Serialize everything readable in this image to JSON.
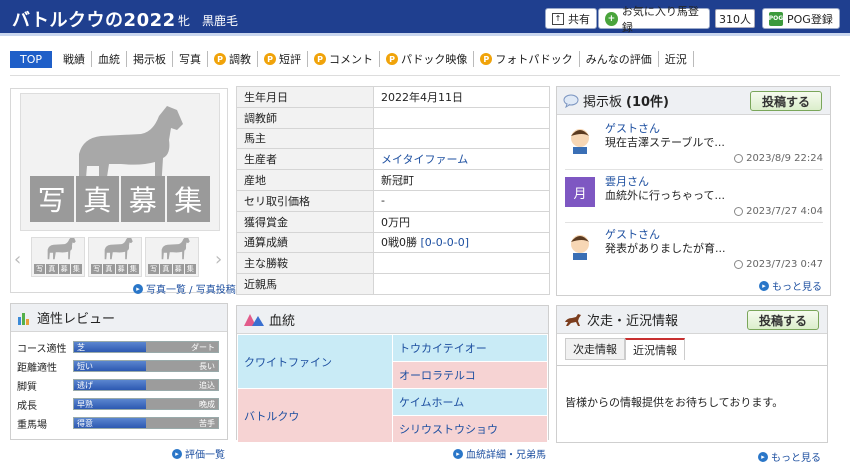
{
  "header": {
    "title": "バトルクウの2022",
    "sex_color": "牝　黒鹿毛",
    "share_label": "共有",
    "favorite_label": "お気に入り馬登録",
    "favorite_count": "310人",
    "pog_label": "POG登録"
  },
  "nav": {
    "items": [
      "TOP",
      "戦績",
      "血統",
      "掲示板",
      "写真",
      "調教",
      "短評",
      "コメント",
      "パドック映像",
      "フォトパドック",
      "みんなの評価",
      "近況"
    ],
    "premium_marker": "P"
  },
  "photo": {
    "caption": [
      "写",
      "真",
      "募",
      "集"
    ],
    "links": "写真一覧 / 写真投稿"
  },
  "info": {
    "rows": [
      {
        "key": "生年月日",
        "value": "2022年4月11日"
      },
      {
        "key": "調教師",
        "value": ""
      },
      {
        "key": "馬主",
        "value": ""
      },
      {
        "key": "生産者",
        "value": "メイタイファーム"
      },
      {
        "key": "産地",
        "value": "新冠町"
      },
      {
        "key": "セリ取引価格",
        "value": "-"
      },
      {
        "key": "獲得賞金",
        "value": "0万円"
      },
      {
        "key": "通算成績",
        "value": "0戦0勝",
        "link": "[0-0-0-0]"
      },
      {
        "key": "主な勝鞍",
        "value": ""
      },
      {
        "key": "近親馬",
        "value": ""
      }
    ]
  },
  "board": {
    "title": "掲示板",
    "count": "(10件)",
    "post_button": "投稿する",
    "posts": [
      {
        "name": "ゲストさん",
        "text": "現在吉澤ステーブルで...",
        "date": "2023/8/9 22:24"
      },
      {
        "name": "雲月さん",
        "text": "血統外に行っちゃって...",
        "date": "2023/7/27 4:04",
        "avatar_char": "月"
      },
      {
        "name": "ゲストさん",
        "text": "発表がありましたが育...",
        "date": "2023/7/23 0:47"
      }
    ],
    "more": "もっと見る"
  },
  "aptitude": {
    "title": "適性レビュー",
    "rows": [
      {
        "label": "コース適性",
        "left": "芝",
        "right": "ダート",
        "level": 0.5
      },
      {
        "label": "距離適性",
        "left": "短い",
        "right": "長い",
        "level": 0.5
      },
      {
        "label": "脚質",
        "left": "逃げ",
        "right": "追込",
        "level": 0.5
      },
      {
        "label": "成長",
        "left": "早熟",
        "right": "晩成",
        "level": 0.5
      },
      {
        "label": "重馬場",
        "left": "得意",
        "right": "苦手",
        "level": 0.5
      }
    ],
    "link": "評価一覧"
  },
  "pedigree": {
    "title": "血統",
    "sire": "クワイトファイン",
    "sire_sire": "トウカイテイオー",
    "sire_dam": "オーロラテルコ",
    "dam": "バトルクウ",
    "dam_sire": "ケイムホーム",
    "dam_dam": "シリウストウショウ",
    "link": "血統詳細・兄弟馬"
  },
  "recent": {
    "title": "次走・近況情報",
    "post_button": "投稿する",
    "tabs": [
      "次走情報",
      "近況情報"
    ],
    "message": "皆様からの情報提供をお待ちしております。",
    "more": "もっと見る"
  },
  "colors": {
    "header_bg": "#1f3f8f",
    "nav_active": "#1f5fc8",
    "link": "#1d4fa0",
    "premium": "#f0a30a",
    "sire_line": "#c9ebf6",
    "dam_line": "#f6d3d3"
  }
}
